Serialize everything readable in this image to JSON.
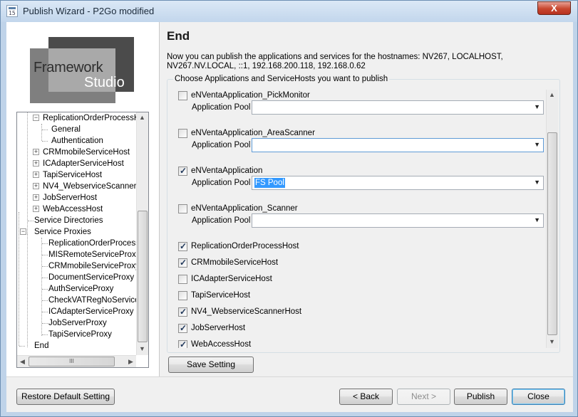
{
  "window": {
    "title": "Publish Wizard - P2Go modified",
    "close_glyph": "X",
    "icon_text": "15"
  },
  "logo": {
    "line1": "Framework",
    "line2": "Studio"
  },
  "tree": {
    "items": [
      {
        "label": "ReplicationOrderProcessH"
      },
      {
        "label": "General"
      },
      {
        "label": "Authentication"
      },
      {
        "label": "CRMmobileServiceHost"
      },
      {
        "label": "ICAdapterServiceHost"
      },
      {
        "label": "TapiServiceHost"
      },
      {
        "label": "NV4_WebserviceScanner"
      },
      {
        "label": "JobServerHost"
      },
      {
        "label": "WebAccessHost"
      },
      {
        "label": "Service Directories"
      },
      {
        "label": "Service Proxies"
      },
      {
        "label": "ReplicationOrderProcessPr"
      },
      {
        "label": "MISRemoteServiceProxy"
      },
      {
        "label": "CRMmobileServiceProxy"
      },
      {
        "label": "DocumentServiceProxy"
      },
      {
        "label": "AuthServiceProxy"
      },
      {
        "label": "CheckVATRegNoServiceP"
      },
      {
        "label": "ICAdapterServiceProxy"
      },
      {
        "label": "JobServerProxy"
      },
      {
        "label": "TapiServiceProxy"
      },
      {
        "label": "End"
      }
    ],
    "hscroll_grip": "III"
  },
  "page": {
    "heading": "End",
    "description": "Now you can publish the applications and services for the hostnames: NV267, LOCALHOST, NV267.NV.LOCAL, ::1, 192.168.200.118, 192.168.0.62",
    "group_title": "Choose Applications and ServiceHosts you want to publish",
    "pool_label": "Application Pool",
    "apps": [
      {
        "label": "eNVentaApplication_PickMonitor",
        "checked": false,
        "pool": ""
      },
      {
        "label": "eNVentaApplication_AreaScanner",
        "checked": false,
        "pool": ""
      },
      {
        "label": "eNVentaApplication",
        "checked": true,
        "pool": "FS Pool"
      },
      {
        "label": "eNVentaApplication_Scanner",
        "checked": false,
        "pool": ""
      }
    ],
    "hosts": [
      {
        "label": "ReplicationOrderProcessHost",
        "checked": true
      },
      {
        "label": "CRMmobileServiceHost",
        "checked": true
      },
      {
        "label": "ICAdapterServiceHost",
        "checked": false
      },
      {
        "label": "TapiServiceHost",
        "checked": false
      },
      {
        "label": "NV4_WebserviceScannerHost",
        "checked": true
      },
      {
        "label": "JobServerHost",
        "checked": true
      },
      {
        "label": "WebAccessHost",
        "checked": true
      }
    ],
    "save_button": "Save Setting"
  },
  "footer": {
    "restore": "Restore Default Setting",
    "back": "< Back",
    "next": "Next >",
    "publish": "Publish",
    "close": "Close"
  }
}
